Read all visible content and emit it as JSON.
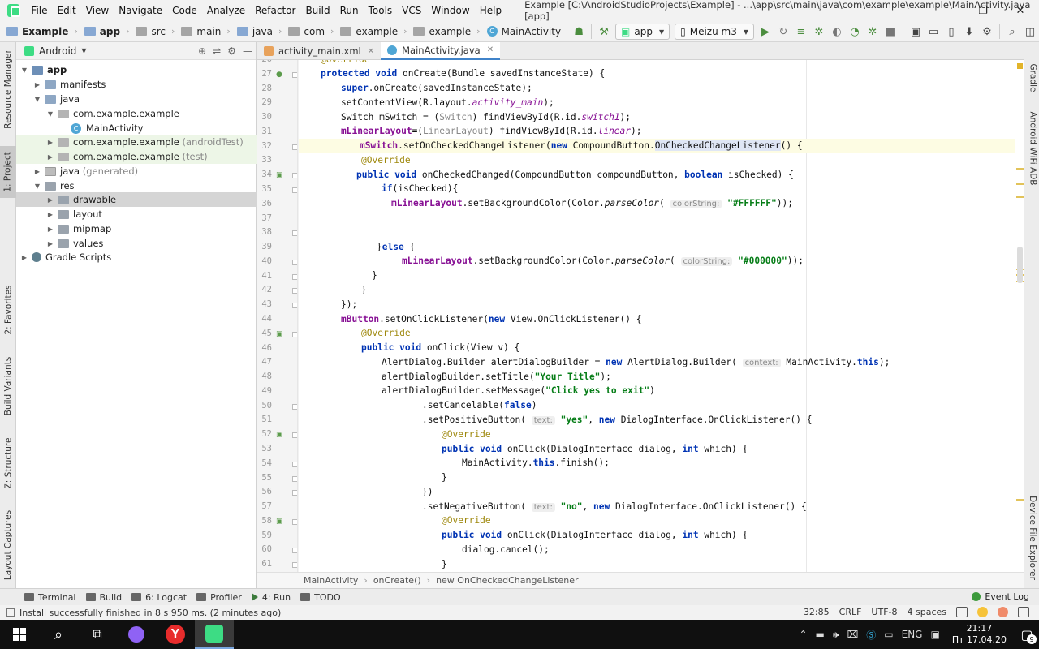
{
  "window": {
    "title": "Example [C:\\AndroidStudioProjects\\Example] - ...\\app\\src\\main\\java\\com\\example\\example\\MainActivity.java [app]",
    "menu": [
      "File",
      "Edit",
      "View",
      "Navigate",
      "Code",
      "Analyze",
      "Refactor",
      "Build",
      "Run",
      "Tools",
      "VCS",
      "Window",
      "Help"
    ],
    "controls": [
      "—",
      "❐",
      "✕"
    ]
  },
  "breadcrumbs": [
    "Example",
    "app",
    "src",
    "main",
    "java",
    "com",
    "example",
    "example",
    "MainActivity"
  ],
  "toolbar": {
    "run_config": "app",
    "device": "Meizu m3"
  },
  "project": {
    "view": "Android",
    "tree": [
      {
        "label": "app",
        "dim": ""
      },
      {
        "label": "manifests",
        "dim": ""
      },
      {
        "label": "java",
        "dim": ""
      },
      {
        "label": "com.example.example",
        "dim": ""
      },
      {
        "label": "MainActivity",
        "dim": ""
      },
      {
        "label": "com.example.example",
        "dim": "(androidTest)"
      },
      {
        "label": "com.example.example",
        "dim": "(test)"
      },
      {
        "label": "java",
        "dim": "(generated)"
      },
      {
        "label": "res",
        "dim": ""
      },
      {
        "label": "drawable",
        "dim": ""
      },
      {
        "label": "layout",
        "dim": ""
      },
      {
        "label": "mipmap",
        "dim": ""
      },
      {
        "label": "values",
        "dim": ""
      },
      {
        "label": "Gradle Scripts",
        "dim": ""
      }
    ]
  },
  "left_strip": [
    "Resource Manager",
    "1: Project",
    "2: Favorites",
    "Build Variants",
    "Z: Structure",
    "Layout Captures"
  ],
  "right_strip": [
    "Gradle",
    "Android WiFi ADB",
    "Device File Explorer"
  ],
  "editor": {
    "tabs": [
      "activity_main.xml",
      "MainActivity.java"
    ],
    "line_numbers": [
      "26",
      "27",
      "28",
      "29",
      "30",
      "31",
      "32",
      "33",
      "34",
      "35",
      "36",
      "37",
      "38",
      "39",
      "40",
      "41",
      "42",
      "43",
      "44",
      "45",
      "46",
      "47",
      "48",
      "49",
      "50",
      "51",
      "52",
      "53",
      "54",
      "55",
      "56",
      "57",
      "58",
      "59",
      "60",
      "61"
    ],
    "code_crumbs": [
      "MainActivity",
      "onCreate()",
      "new OnCheckedChangeListener"
    ]
  },
  "bottom_tools": [
    "Terminal",
    "Build",
    "6: Logcat",
    "Profiler",
    "4: Run",
    "TODO"
  ],
  "event_log": "Event Log",
  "status": {
    "message": "Install successfully finished in 8 s 950 ms. (2 minutes ago)",
    "position": "32:85",
    "line_sep": "CRLF",
    "encoding": "UTF-8",
    "indent": "4 spaces"
  },
  "taskbar": {
    "lang": "ENG",
    "time": "21:17",
    "date": "Пт 17.04.20",
    "notif_count": "9"
  },
  "colors": {
    "accent": "#4083c9",
    "android_green": "#3ddc84",
    "keyword": "#0033b3",
    "field": "#871094",
    "string": "#067d17",
    "annotation": "#9e880d"
  }
}
